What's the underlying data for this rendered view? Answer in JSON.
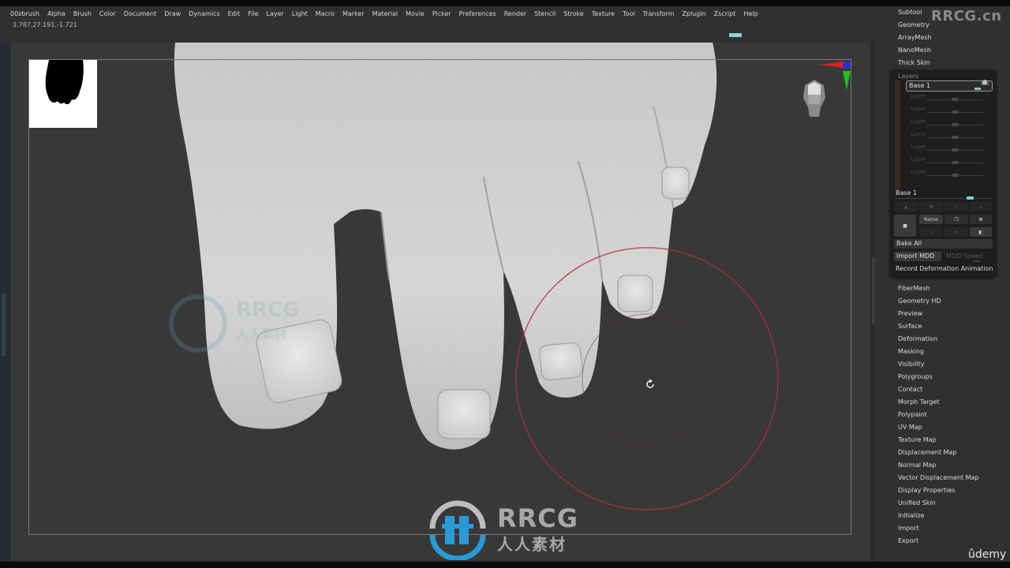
{
  "menubar": {
    "items": [
      "00zbrush",
      "Alpha",
      "Brush",
      "Color",
      "Document",
      "Draw",
      "Dynamics",
      "Edit",
      "File",
      "Layer",
      "Light",
      "Macro",
      "Marker",
      "Material",
      "Movie",
      "Picker",
      "Preferences",
      "Render",
      "Stencil",
      "Stroke",
      "Texture",
      "Tool",
      "Transform",
      "Zplugin",
      "Zscript",
      "Help"
    ]
  },
  "status": {
    "coords": "3.787,27.191,-1.721"
  },
  "tool_panel": {
    "top_items": [
      "Subtool",
      "Geometry",
      "ArrayMesh",
      "NanoMesh",
      "Thick Skin"
    ],
    "layers": {
      "title": "Layers",
      "active_layer": "Base 1",
      "rec_label": "REC",
      "inactive_layers": [
        "Layer",
        "Layer",
        "Layer",
        "Layer",
        "Layer",
        "Layer",
        "Layer"
      ],
      "current_name": "Base 1",
      "name_button": "Name",
      "bake_all": "Bake All",
      "import_mdd": "Import MDD",
      "mdd_speed": "MDD Speed",
      "record_anim": "Record Deformation Animation"
    },
    "bottom_items": [
      "FiberMesh",
      "Geometry HD",
      "Preview",
      "Surface",
      "Deformation",
      "Masking",
      "Visibility",
      "Polygroups",
      "Contact",
      "Morph Target",
      "Polypaint",
      "UV Map",
      "Texture Map",
      "Displacement Map",
      "Normal Map",
      "Vector Displacement Map",
      "Display Properties",
      "Unified Skin",
      "Initialize",
      "Import",
      "Export"
    ]
  },
  "watermarks": {
    "top_right": "RRCG.cn",
    "center_latin": "RRCG",
    "center_cn": "人人素材",
    "udemy": "ûdemy"
  },
  "colors": {
    "accent_cyan": "#7fd0c8",
    "brush_ring": "#b0303c",
    "gizmo_x": "#e02020",
    "gizmo_y": "#20c020",
    "gizmo_z": "#2030e0",
    "watermark_blue": "#2a9ad8"
  },
  "viewport": {
    "model": "sculpted foot (toes close-up)",
    "cursor": "rotate-cursor"
  }
}
